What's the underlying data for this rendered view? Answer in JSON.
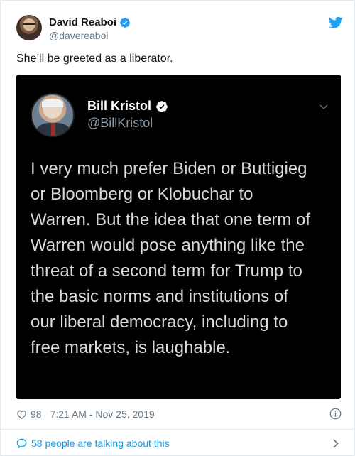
{
  "author": {
    "display_name": "David Reaboi",
    "handle": "@davereaboi"
  },
  "tweet": {
    "text": "She’ll be greeted as a liberator."
  },
  "embedded": {
    "display_name": "Bill Kristol",
    "handle": "@BillKristol",
    "lines": [
      "I very much prefer Biden or Buttigieg",
      "or Bloomberg or Klobuchar to",
      "Warren. But the idea that one term of",
      "Warren would pose anything like the",
      "threat of a second term for Trump to",
      "the basic norms and institutions of",
      "our liberal democracy, including to",
      "free markets, is laughable."
    ]
  },
  "footer": {
    "likes": "98",
    "timestamp": "7:21 AM - Nov 25, 2019",
    "talking": "58 people are talking about this"
  },
  "colors": {
    "twitter_blue": "#1da1f2",
    "link_blue": "#1b95e0",
    "muted": "#657786"
  },
  "icons": [
    "verified-icon",
    "twitter-bird-icon",
    "heart-icon",
    "info-icon",
    "speech-bubble-icon",
    "chevron-right-icon",
    "chevron-down-icon"
  ]
}
